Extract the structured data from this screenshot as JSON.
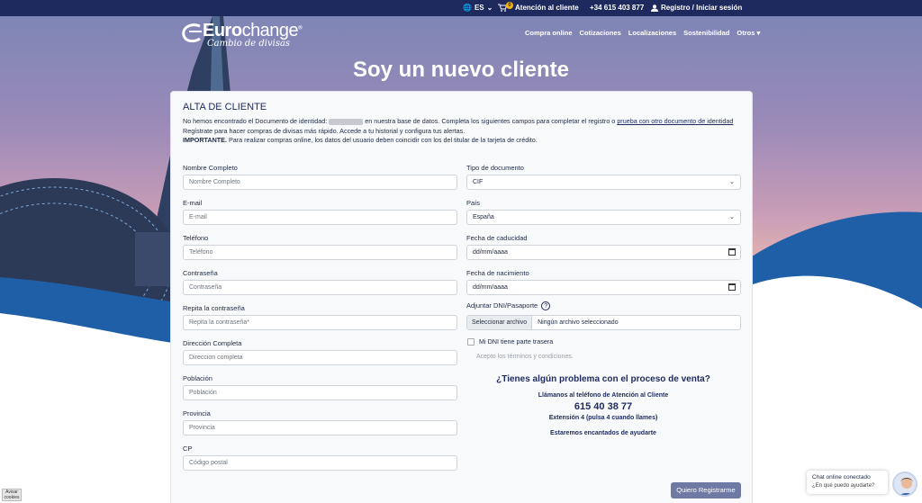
{
  "topbar": {
    "language": "ES",
    "cart_count": "0",
    "customer_service": "Atención al cliente",
    "phone": "+34 615 403 877",
    "account": "Registro / Iniciar sesión"
  },
  "brand": {
    "name_bold": "Euro",
    "name_light": "change",
    "trademark": "®",
    "tagline": "Cambio de divisas"
  },
  "nav": [
    "Compra online",
    "Cotizaciones",
    "Localizaciones",
    "Sostenibilidad",
    "Otros"
  ],
  "page_title": "Soy un nuevo cliente",
  "form": {
    "title": "ALTA DE CLIENTE",
    "intro_1a": "No hemos encontrado el Documento de identidad:",
    "intro_1b": "en nuestra base de datos. Completa los siguientes campos para completar el registro o",
    "intro_link": "prueba con otro documento de identidad",
    "intro_2": "Regístrate para hacer compras de divisas más rápido. Accede a tu historial y configura tus alertas.",
    "intro_3_bold": "IMPORTANTE.",
    "intro_3": "Para realizar compras online, los datos del usuario deben coincidir con los del titular de la tarjeta de crédito.",
    "left_fields": [
      {
        "label": "Nombre Completo",
        "placeholder": "Nombre Completo"
      },
      {
        "label": "E-mail",
        "placeholder": "E-mail"
      },
      {
        "label": "Teléfono",
        "placeholder": "Teléfono"
      },
      {
        "label": "Contraseña",
        "placeholder": "Contraseña"
      },
      {
        "label": "Repita la contraseña",
        "placeholder": "Repita la contraseña*"
      },
      {
        "label": "Dirección Completa",
        "placeholder": "Direccion completa"
      },
      {
        "label": "Población",
        "placeholder": "Población"
      },
      {
        "label": "Provincia",
        "placeholder": "Provincia"
      },
      {
        "label": "CP",
        "placeholder": "Código postal"
      }
    ],
    "doc_type": {
      "label": "Tipo de documento",
      "value": "CIF"
    },
    "country": {
      "label": "País",
      "value": "España"
    },
    "expiry": {
      "label": "Fecha de caducidad",
      "value": "dd/mm/aaaa"
    },
    "birth": {
      "label": "Fecha de nacimiento",
      "value": "dd/mm/aaaa"
    },
    "upload": {
      "label": "Adjuntar DNI/Pasaporte",
      "help": "?",
      "button": "Seleccionar archivo",
      "filename": "Ningún archivo seleccionado"
    },
    "back_side": "Mi DNI tiene parte trasera",
    "terms": "Acepto los términos y condiciones.",
    "submit": "Quiero Registrarme"
  },
  "help": {
    "title": "¿Tienes algún problema con el proceso de venta?",
    "call": "Llámanos al teléfono de Atención al Cliente",
    "phone": "615 40 38 77",
    "extension": "Extensión 4 (pulsa 4 cuando llames)",
    "closing": "Estaremos encantados de ayudarte"
  },
  "chat": {
    "title": "Chat online conectado",
    "subtitle": "¿En qué puedo ayudarte?"
  },
  "cookies": {
    "line1": "Avisar",
    "line2": "cookies"
  },
  "colors": {
    "navy": "#1e2a5e",
    "wave_blue": "#1f5fa8",
    "submit": "#6e7aa3"
  }
}
